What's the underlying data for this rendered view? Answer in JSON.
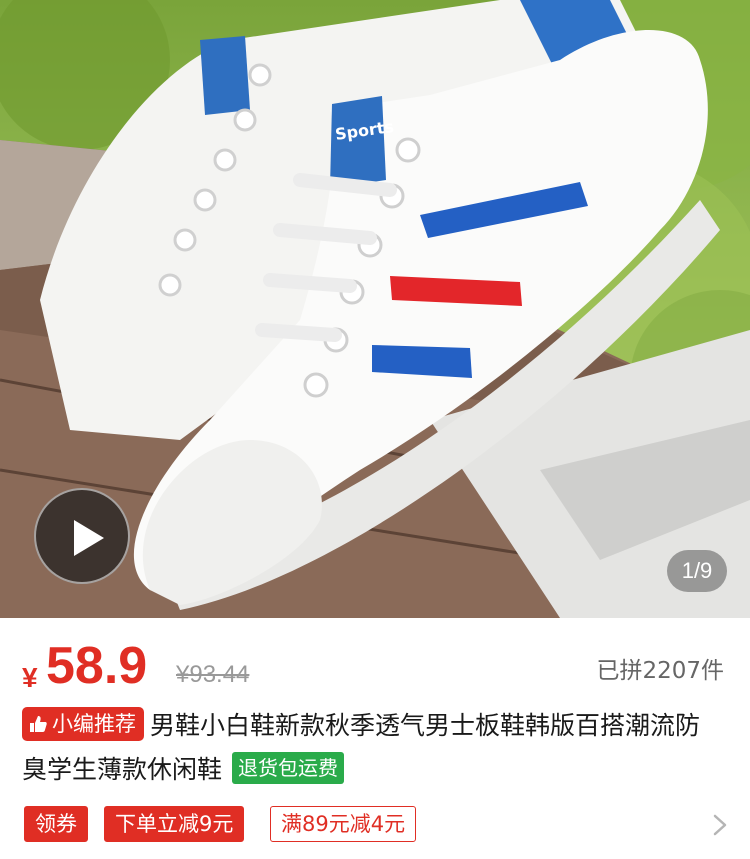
{
  "gallery": {
    "counter": "1/9",
    "play_label": "play-video"
  },
  "price": {
    "currency": "¥",
    "current": "58.9",
    "original": "¥93.44",
    "sold": "已拼2207件"
  },
  "title": {
    "badge": "小编推荐",
    "text": "男鞋小白鞋新款秋季透气男士板鞋韩版百搭潮流防臭学生薄款休闲鞋",
    "return_badge": "退货包运费"
  },
  "coupons": {
    "get_label": "领券",
    "items": [
      "下单立减9元",
      "满89元减4元"
    ]
  },
  "colors": {
    "accent": "#e02e24",
    "green_badge": "#2aab4a"
  },
  "icons": {
    "play": "play-icon",
    "thumb": "thumbs-up-icon",
    "chevron": "chevron-right-icon"
  }
}
